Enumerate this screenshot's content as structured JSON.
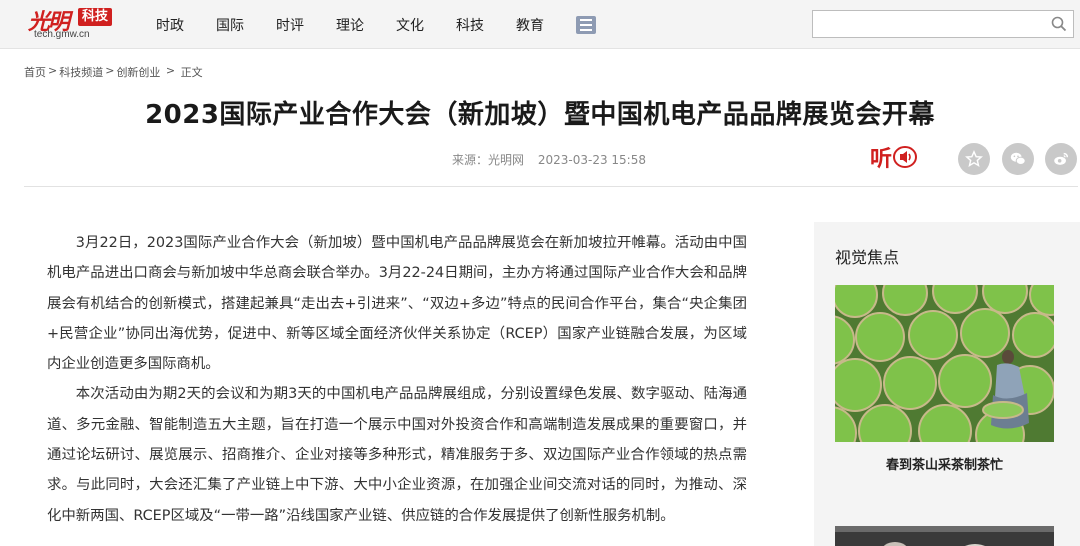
{
  "header": {
    "logo_mark": "光明",
    "logo_badge": "科技",
    "logo_url": "tech.gmw.cn",
    "nav": [
      "时政",
      "国际",
      "时评",
      "理论",
      "文化",
      "科技",
      "教育"
    ],
    "search_placeholder": ""
  },
  "breadcrumb": [
    {
      "label": "首页"
    },
    {
      "label": "科技频道"
    },
    {
      "label": "创新创业"
    },
    {
      "label": "正文"
    }
  ],
  "breadcrumb_separators": [
    ">",
    ">",
    " > "
  ],
  "article": {
    "title": "2023国际产业合作大会（新加坡）暨中国机电产品品牌展览会开幕",
    "source": "来源：光明网",
    "datetime": "2023-03-23 15:58",
    "listen_label": "听",
    "paragraphs": [
      "3月22日，2023国际产业合作大会（新加坡）暨中国机电产品品牌展览会在新加坡拉开帷幕。活动由中国机电产品进出口商会与新加坡中华总商会联合举办。3月22-24日期间，主办方将通过国际产业合作大会和品牌展会有机结合的创新模式，搭建起兼具“走出去+引进来”、“双边+多边”特点的民间合作平台，集合“央企集团+民营企业”协同出海优势，促进中、新等区域全面经济伙伴关系协定（RCEP）国家产业链融合发展，为区域内企业创造更多国际商机。",
      "本次活动由为期2天的会议和为期3天的中国机电产品品牌展组成，分别设置绿色发展、数字驱动、陆海通道、多元金融、智能制造五大主题，旨在打造一个展示中国对外投资合作和高端制造发展成果的重要窗口，并通过论坛研讨、展览展示、招商推介、企业对接等多种形式，精准服务于多、双边国际产业合作领域的热点需求。与此同时，大会还汇集了产业链上中下游、大中小企业资源，在加强企业间交流对话的同时，为推动、深化中新两国、RCEP区域及“一带一路”沿线国家产业链、供应链的合作发展提供了创新性服务机制。"
    ]
  },
  "sidebar": {
    "title": "视觉焦点",
    "caption": "春到茶山采茶制茶忙"
  },
  "icons": {
    "search": "search-icon",
    "menu": "menu-icon",
    "favorite": "star-icon",
    "wechat": "wechat-icon",
    "weibo": "weibo-icon",
    "listen": "speaker-icon"
  },
  "colors": {
    "brand_red": "#d0201f",
    "share_gray": "#c9c9c9"
  }
}
